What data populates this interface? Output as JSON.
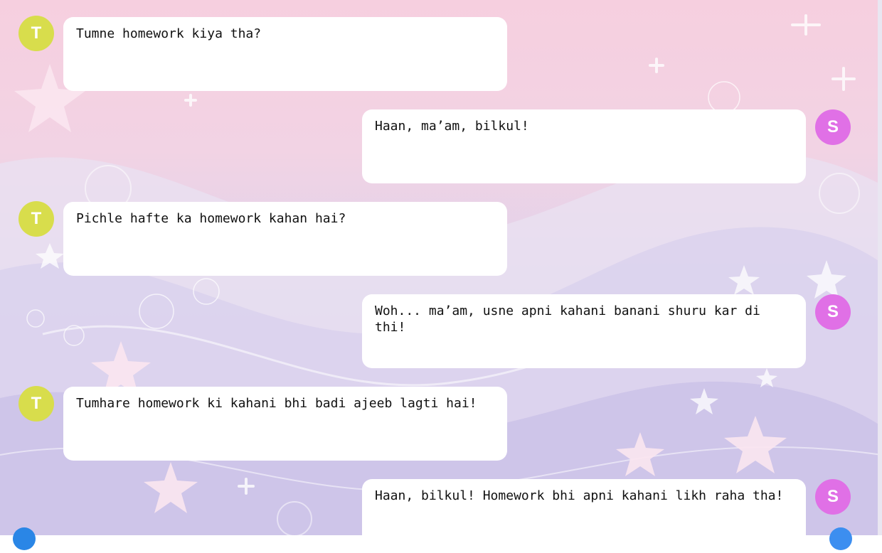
{
  "chat": {
    "messages": [
      {
        "sender": "teacher",
        "avatar": "T",
        "text": "Tumne homework kiya tha?"
      },
      {
        "sender": "student",
        "avatar": "S",
        "text": "Haan, ma’am, bilkul!"
      },
      {
        "sender": "teacher",
        "avatar": "T",
        "text": "Pichle hafte ka homework kahan hai?"
      },
      {
        "sender": "student",
        "avatar": "S",
        "text": "Woh... ma’am, usne apni kahani banani shuru kar di thi!"
      },
      {
        "sender": "teacher",
        "avatar": "T",
        "text": "Tumhare homework ki kahani bhi badi ajeeb lagti hai!"
      },
      {
        "sender": "student",
        "avatar": "S",
        "text": "Haan, bilkul! Homework bhi apni kahani likh raha tha!"
      }
    ]
  },
  "colors": {
    "teacher_avatar": "#d8dd4c",
    "student_avatar": "#e070e6",
    "bubble": "#ffffff"
  }
}
